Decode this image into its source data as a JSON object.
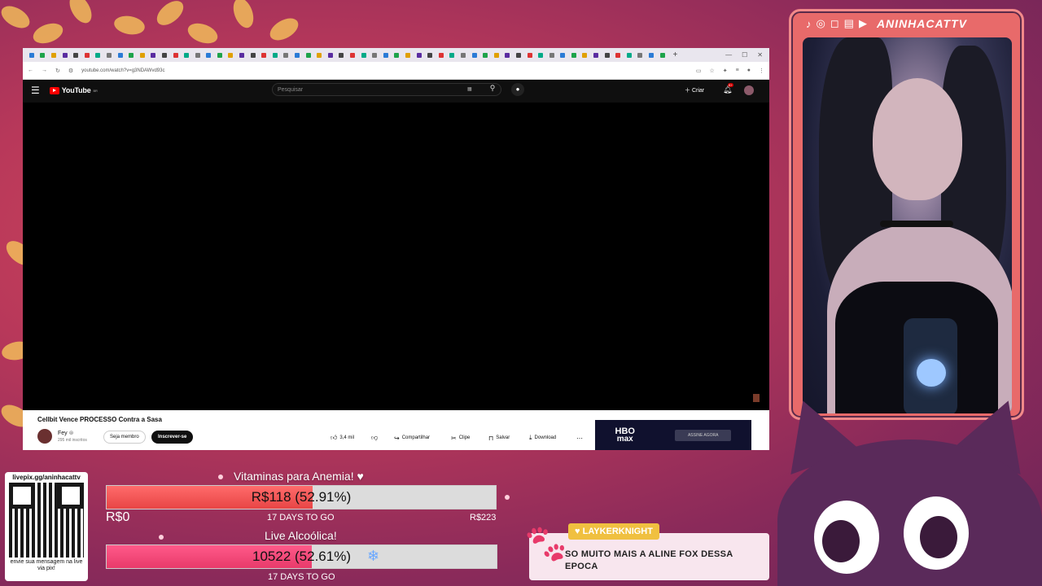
{
  "browser": {
    "tab_icons": [
      "tab",
      "tab",
      "tab",
      "tab",
      "tab",
      "tab",
      "tab",
      "tab",
      "tab",
      "tab",
      "tab",
      "tab",
      "tab",
      "tab",
      "tab",
      "tab",
      "tab",
      "tab",
      "tab",
      "tab",
      "tab",
      "tab",
      "tab",
      "tab",
      "tab",
      "tab",
      "tab",
      "tab",
      "tab",
      "tab",
      "tab",
      "tab",
      "tab",
      "tab",
      "tab",
      "tab",
      "tab",
      "tab",
      "tab",
      "tab",
      "tab",
      "tab",
      "tab",
      "tab",
      "tab",
      "tab",
      "tab",
      "tab",
      "tab",
      "tab",
      "tab",
      "tab",
      "tab",
      "tab",
      "tab",
      "tab",
      "tab",
      "tab"
    ],
    "new_tab": "+",
    "url": "youtube.com/watch?v=g3NDAWvd93c"
  },
  "youtube": {
    "logo": "YouTube",
    "region": "BR",
    "search_placeholder": "Pesquisar",
    "create_label": "Criar",
    "notif_badge": "9+",
    "video_title": "Cellbit Vence PROCESSO Contra a Sasa",
    "channel_name": "Fey",
    "channel_subs": "295 mil inscritos",
    "join_label": "Seja membro",
    "subscribe_label": "Inscrever-se",
    "likes": "3,4 mil",
    "share_label": "Compartilhar",
    "clip_label": "Clipe",
    "save_label": "Salvar",
    "download_label": "Download",
    "ad": {
      "logo_line1": "HBO",
      "logo_line2": "max",
      "cta": "ASSINE AGORA"
    }
  },
  "stream": {
    "channel_name": "ANINHACATTV",
    "social_icons": [
      "tiktok-icon",
      "discord-icon",
      "instagram-icon",
      "twitch-icon",
      "youtube-icon"
    ]
  },
  "goals": [
    {
      "title": "Vitaminas para Anemia! ♥",
      "bar_text": "R$118 (52.91%)",
      "progress": 0.5291,
      "days": "17 DAYS TO GO",
      "min": "R$0",
      "max": "R$223"
    },
    {
      "title": "Live Alcoólica!",
      "bar_text": "10522 (52.61%)",
      "progress": 0.5261,
      "days": "17 DAYS TO GO"
    }
  ],
  "qr": {
    "top": "livepix.gg/aninhacattv",
    "bottom": "envie sua mensagem na live via pix!"
  },
  "chat_alert": {
    "user": "LAYKERKNIGHT",
    "message": "SO MUITO MAIS A ALINE FOX DESSA EPOCA"
  },
  "colors": {
    "accent": "#e84545",
    "bar_bg": "#dcdcdc",
    "alert_user_bg": "#f0c040"
  }
}
